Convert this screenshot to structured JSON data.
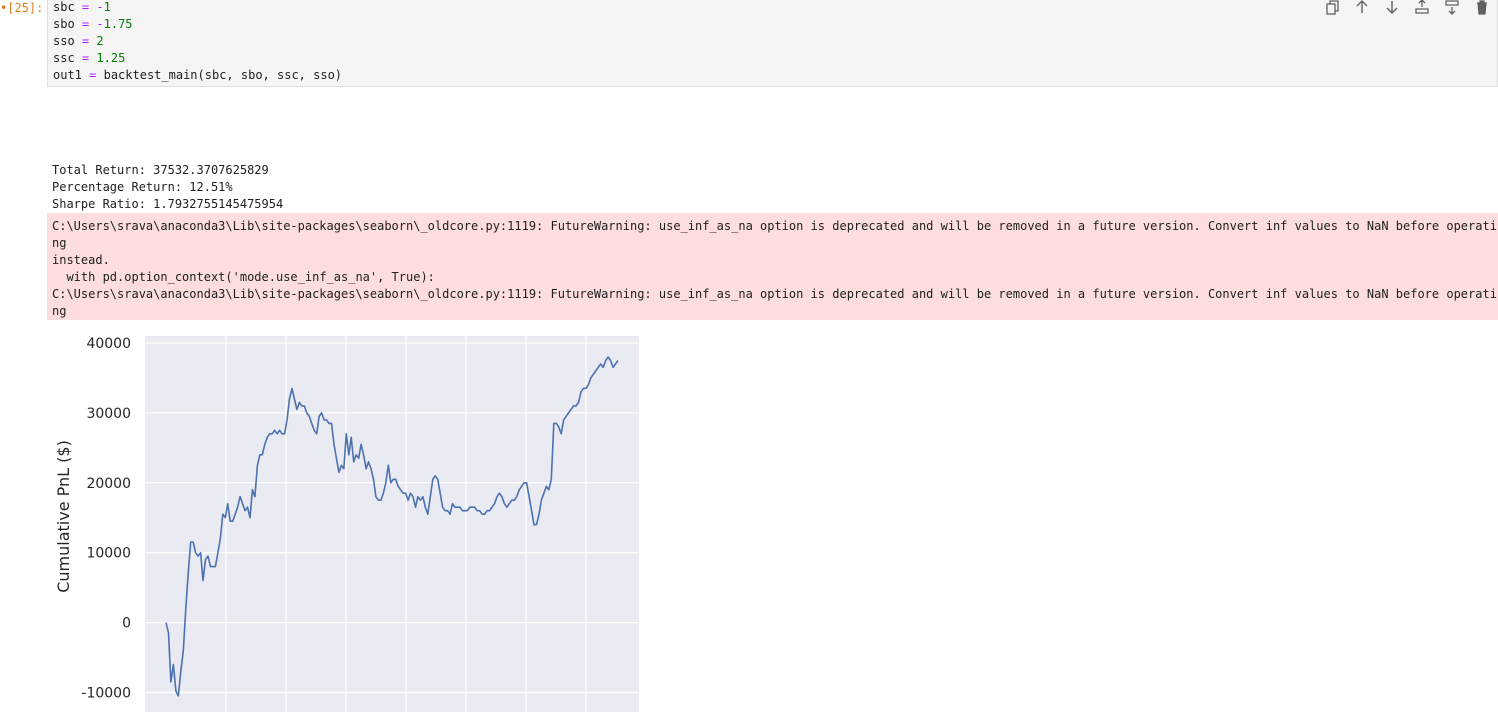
{
  "cell": {
    "prompt": "[25]:",
    "prompt_marker": "•",
    "code": [
      {
        "var": "sbc",
        "op": "=",
        "val": "-1"
      },
      {
        "var": "sbo",
        "op": "=",
        "val": "-1.75"
      },
      {
        "var": "sso",
        "op": "=",
        "val": "2"
      },
      {
        "var": "ssc",
        "op": "=",
        "val": "1.25"
      }
    ],
    "last_line": {
      "var": "out1",
      "op": "=",
      "call": "backtest_main(sbc, sbo, ssc, sso)"
    }
  },
  "toolbar": [
    {
      "name": "duplicate-cell-button",
      "icon": "duplicate-icon"
    },
    {
      "name": "move-up-button",
      "icon": "arrow-up-icon"
    },
    {
      "name": "move-down-button",
      "icon": "arrow-down-icon"
    },
    {
      "name": "insert-above-button",
      "icon": "insert-above-icon"
    },
    {
      "name": "insert-below-button",
      "icon": "insert-below-icon"
    },
    {
      "name": "delete-cell-button",
      "icon": "trash-icon"
    }
  ],
  "stdout": [
    "Total Return: 37532.3707625829",
    "Percentage Return: 12.51%",
    "Sharpe Ratio: 1.7932755145475954"
  ],
  "stderr": [
    "C:\\Users\\srava\\anaconda3\\Lib\\site-packages\\seaborn\\_oldcore.py:1119: FutureWarning: use_inf_as_na option is deprecated and will be removed in a future version. Convert inf values to NaN before operating",
    "instead.",
    "  with pd.option_context('mode.use_inf_as_na', True):",
    "C:\\Users\\srava\\anaconda3\\Lib\\site-packages\\seaborn\\_oldcore.py:1119: FutureWarning: use_inf_as_na option is deprecated and will be removed in a future version. Convert inf values to NaN before operating",
    "instead.",
    "  with pd.option_context('mode.use_inf_as_na', True):"
  ],
  "colors": {
    "plot_bg": "#eaeaf2",
    "line": "#4c72b0",
    "stderr_bg": "#fddddd",
    "prompt": "#e07b1a"
  },
  "chart_data": {
    "type": "line",
    "title": "",
    "xlabel": "",
    "ylabel": "Cumulative PnL ($)",
    "ylim": [
      -12800,
      41000
    ],
    "yticks": [
      -10000,
      0,
      10000,
      20000,
      30000,
      40000
    ],
    "grid": true,
    "series": [
      {
        "values": [
          0,
          -1500,
          -8500,
          -6000,
          -9800,
          -10500,
          -7000,
          -4000,
          2000,
          7000,
          11500,
          11500,
          10000,
          9500,
          10000,
          6000,
          9000,
          9500,
          8000,
          8000,
          8000,
          10000,
          12000,
          15500,
          15000,
          17000,
          14500,
          14500,
          15500,
          16500,
          18000,
          17000,
          16000,
          16500,
          15000,
          19000,
          18000,
          22500,
          24000,
          24000,
          25500,
          26500,
          27000,
          27000,
          27500,
          27000,
          27500,
          27000,
          27000,
          29000,
          32000,
          33500,
          32000,
          30500,
          31500,
          31000,
          31000,
          30000,
          29500,
          28500,
          27500,
          27000,
          29500,
          30000,
          29000,
          29000,
          28500,
          28500,
          25500,
          23500,
          21500,
          22500,
          22000,
          27000,
          24000,
          26500,
          23000,
          24000,
          23500,
          25500,
          24000,
          22000,
          23000,
          22000,
          20500,
          18000,
          17500,
          17500,
          18500,
          20000,
          22500,
          20000,
          20500,
          20500,
          19500,
          19000,
          18500,
          18500,
          17500,
          18500,
          18000,
          16500,
          18000,
          17500,
          18000,
          16500,
          15500,
          18000,
          20500,
          21000,
          20500,
          18500,
          16500,
          16000,
          16000,
          15500,
          17000,
          16500,
          16500,
          16500,
          16000,
          16000,
          16000,
          16500,
          16500,
          16500,
          16000,
          16000,
          15500,
          15500,
          16000,
          16000,
          16500,
          17000,
          18000,
          18500,
          18000,
          17000,
          16500,
          17000,
          17500,
          17500,
          18000,
          19000,
          19500,
          20000,
          20000,
          18000,
          16000,
          14000,
          14000,
          15500,
          17500,
          18500,
          19500,
          19000,
          20500,
          28500,
          28500,
          28000,
          27000,
          29000,
          29500,
          30000,
          30500,
          31000,
          31000,
          31500,
          33000,
          33500,
          33500,
          34000,
          35000,
          35500,
          36000,
          36500,
          37000,
          36500,
          37500,
          38000,
          37500,
          36500,
          37000,
          37500
        ]
      }
    ]
  }
}
